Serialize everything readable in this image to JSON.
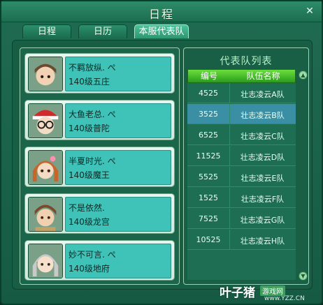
{
  "window": {
    "title": "日程",
    "close_glyph": "✕"
  },
  "tabs": [
    {
      "label": "日程",
      "active": false
    },
    {
      "label": "日历",
      "active": false
    },
    {
      "label": "本服代表队",
      "active": true
    }
  ],
  "players": [
    {
      "name": "不羁放纵.",
      "level": "140级五庄",
      "suffix": "ぺ"
    },
    {
      "name": "大鱼老总.",
      "level": "140级普陀",
      "suffix": "ぺ"
    },
    {
      "name": "半夏时光.",
      "level": "140级魔王",
      "suffix": "ぺ"
    },
    {
      "name": "不是依然.",
      "level": "140级龙宫",
      "suffix": ""
    },
    {
      "name": "妙不可言.",
      "level": "140级地府",
      "suffix": "ぺ"
    }
  ],
  "team_list": {
    "title": "代表队列表",
    "headers": {
      "id": "编号",
      "name": "队伍名称"
    },
    "rows": [
      {
        "id": "4525",
        "name": "壮志凌云A队",
        "selected": false
      },
      {
        "id": "3525",
        "name": "壮志凌云B队",
        "selected": true
      },
      {
        "id": "6525",
        "name": "壮志凌云C队",
        "selected": false
      },
      {
        "id": "11525",
        "name": "壮志凌云D队",
        "selected": false
      },
      {
        "id": "5525",
        "name": "壮志凌云E队",
        "selected": false
      },
      {
        "id": "1525",
        "name": "壮志凌云F队",
        "selected": false
      },
      {
        "id": "7525",
        "name": "壮志凌云G队",
        "selected": false
      },
      {
        "id": "10525",
        "name": "壮志凌云H队",
        "selected": false
      }
    ]
  },
  "watermark": {
    "main": "叶子猪",
    "badge": "游戏网",
    "url": "www.YZZ.CN"
  }
}
